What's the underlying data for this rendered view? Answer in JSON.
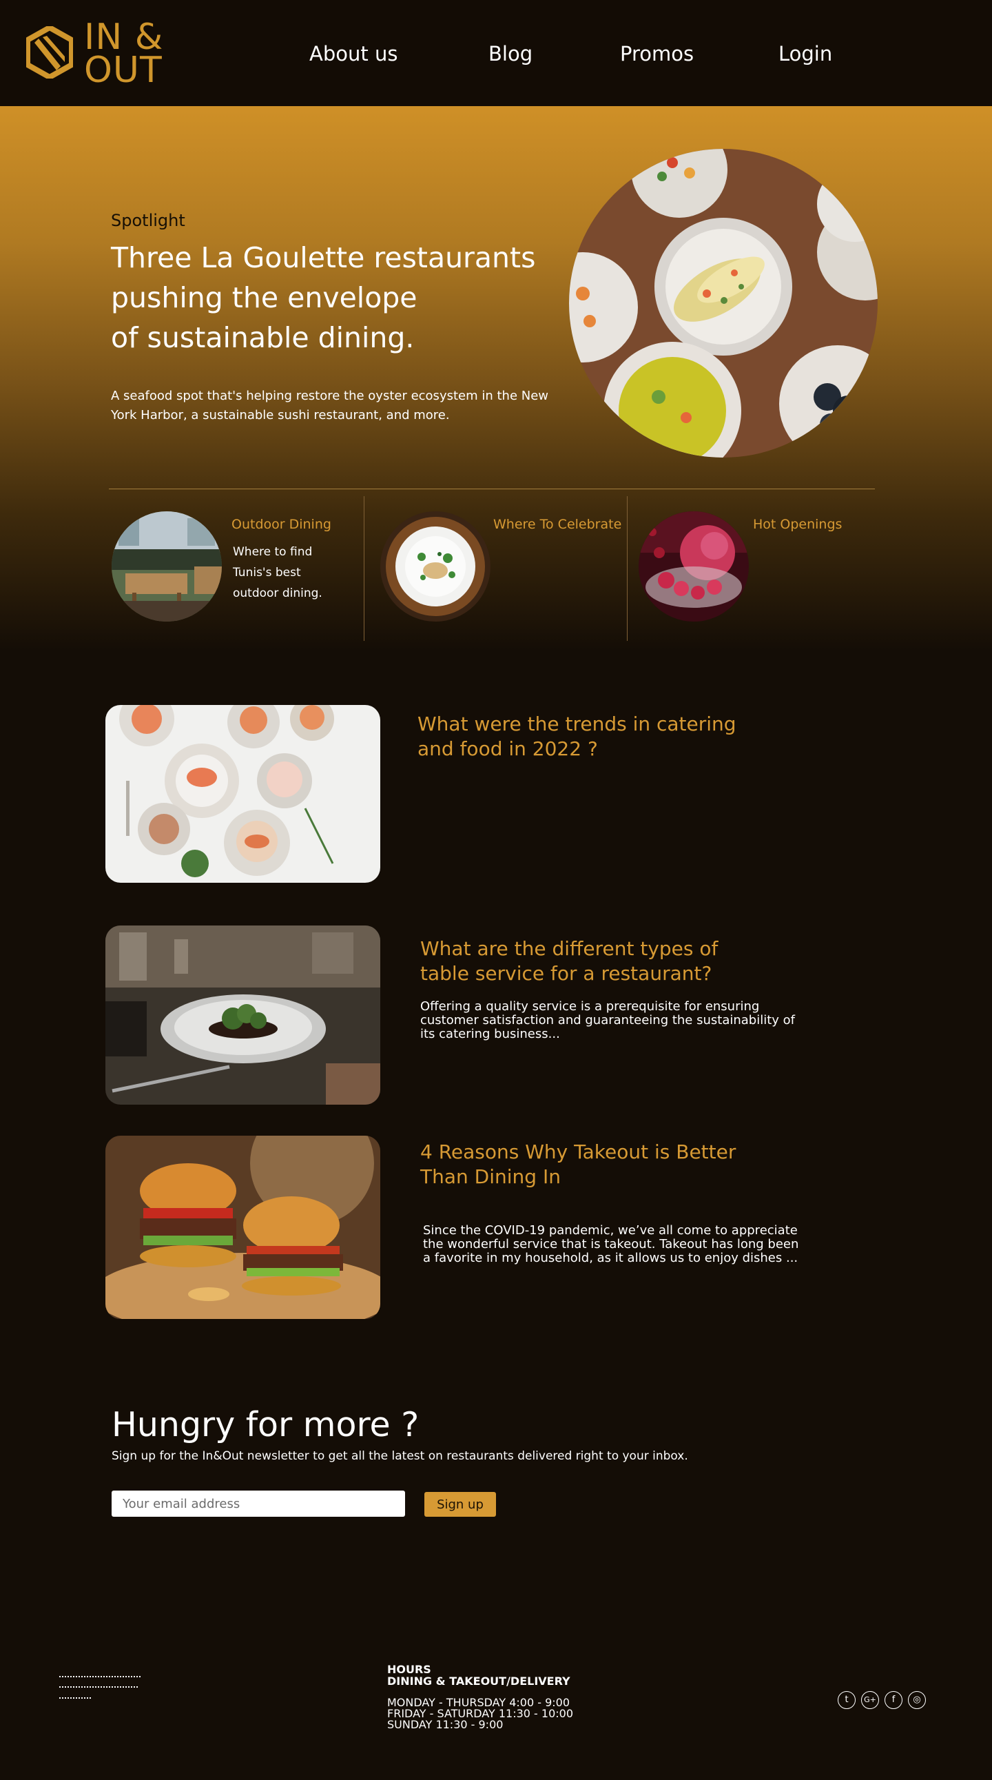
{
  "brand": {
    "logo_text_line1": "IN &",
    "logo_text_line2": "OUT",
    "accent_color": "#d0962c"
  },
  "nav": {
    "items": [
      {
        "label": "About us"
      },
      {
        "label": "Blog"
      },
      {
        "label": "Promos"
      },
      {
        "label": "Login"
      }
    ]
  },
  "spotlight": {
    "label": "Spotlight",
    "title_line1": "Three La Goulette restaurants",
    "title_line2": "pushing the envelope",
    "title_line3": "of sustainable dining.",
    "description": "A seafood spot that's helping restore the oyster ecosystem in the New York Harbor, a sustainable sushi restaurant, and more.",
    "image_icon": "food-platter-photo"
  },
  "categories": [
    {
      "title": "Outdoor Dining",
      "description": "Where to find Tunis's best outdoor dining.",
      "image_icon": "outdoor-terrace-photo"
    },
    {
      "title": "Where To Celebrate",
      "description": "",
      "image_icon": "plated-dish-photo"
    },
    {
      "title": "Hot Openings",
      "description": "",
      "image_icon": "raspberry-dessert-photo"
    }
  ],
  "articles": [
    {
      "title_line1": "What were the trends in catering",
      "title_line2": "and food in 2022 ?",
      "description": "",
      "image_icon": "salmon-plates-photo"
    },
    {
      "title_line1": "What are the different types of",
      "title_line2": "table service for a restaurant?",
      "description_line1": "Offering a quality service is a prerequisite for ensuring",
      "description_line2": "customer satisfaction and guaranteeing the sustainability of",
      "description_line3": "its catering business...",
      "image_icon": "restaurant-plate-photo"
    },
    {
      "title_line1": "4 Reasons Why Takeout is Better",
      "title_line2": "Than Dining In",
      "description_line1": "Since the COVID-19 pandemic, we’ve all come to appreciate",
      "description_line2": "the wonderful service that is takeout. Takeout has long been",
      "description_line3": "a favorite in my household, as it allows us to enjoy dishes ...",
      "image_icon": "burgers-photo"
    }
  ],
  "newsletter": {
    "title": "Hungry for more ?",
    "subtitle": "Sign up for the In&Out newsletter to get all the latest on restaurants delivered right to your inbox.",
    "email_placeholder": "Your email address",
    "button_label": "Sign up"
  },
  "footer": {
    "hours_heading": "HOURS",
    "hours_subheading": "DINING & TAKEOUT/DELIVERY",
    "hours": [
      "MONDAY - THURSDAY 4:00 - 9:00",
      "FRIDAY - SATURDAY 11:30 - 10:00",
      "SUNDAY 11:30 - 9:00"
    ],
    "social": [
      {
        "icon": "twitter-icon",
        "glyph": "t"
      },
      {
        "icon": "google-plus-icon",
        "glyph": "G+"
      },
      {
        "icon": "facebook-icon",
        "glyph": "f"
      },
      {
        "icon": "instagram-icon",
        "glyph": "◎"
      }
    ]
  }
}
